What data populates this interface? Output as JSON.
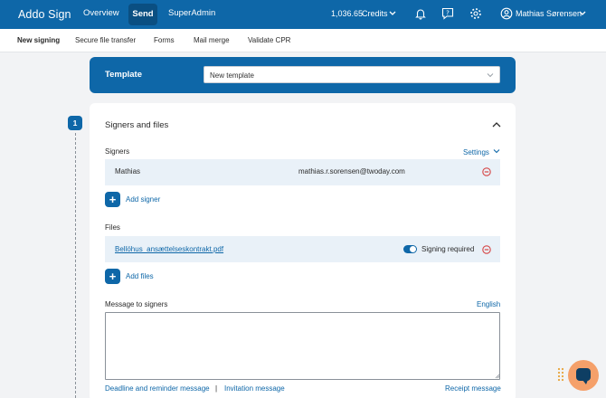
{
  "topbar": {
    "brand": "Addo Sign",
    "nav": [
      "Overview",
      "Send",
      "SuperAdmin"
    ],
    "active_nav": "Send",
    "credits_value": "1,036.65",
    "credits_label": "Credits",
    "user_name": "Mathias Sørensen",
    "icons": [
      "bell-icon",
      "help-icon",
      "gear-icon",
      "user-icon"
    ],
    "bg_color": "#0e67a8"
  },
  "subnav": {
    "items": [
      "New signing",
      "Secure file transfer",
      "Forms",
      "Mail merge",
      "Validate CPR"
    ],
    "active": "New signing"
  },
  "template": {
    "label": "Template",
    "selected": "New template"
  },
  "step": {
    "number": "1",
    "title": "Signers and files"
  },
  "signers": {
    "label": "Signers",
    "settings_link": "Settings",
    "rows": [
      {
        "name": "Mathias",
        "email": "mathias.r.sorensen@twoday.com"
      }
    ],
    "add_label": "Add signer"
  },
  "files": {
    "label": "Files",
    "rows": [
      {
        "name": "Bellöhus_ansættelseskontrakt.pdf",
        "signing_required_label": "Signing required",
        "signing_required": true
      }
    ],
    "add_label": "Add files"
  },
  "message": {
    "label": "Message to signers",
    "language_link": "English",
    "value": ""
  },
  "footer": {
    "deadline_link": "Deadline and reminder message",
    "separator": "|",
    "invitation_link": "Invitation message",
    "receipt_link": "Receipt message"
  }
}
